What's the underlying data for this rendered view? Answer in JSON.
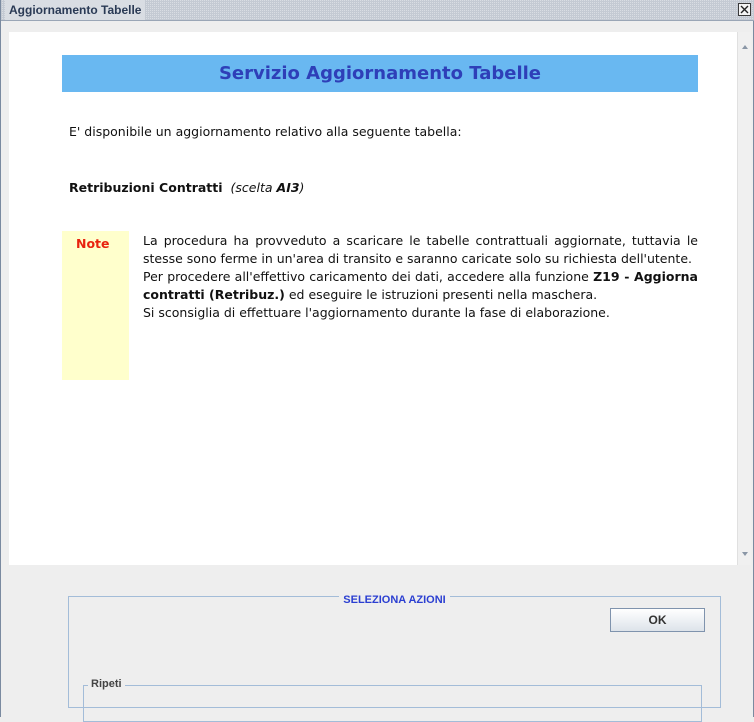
{
  "window": {
    "title": "Aggiornamento Tabelle",
    "close_icon": "close-icon"
  },
  "content": {
    "header": "Servizio Aggiornamento Tabelle",
    "intro": "E' disponibile un aggiornamento relativo alla seguente tabella:",
    "table_name": "Retribuzioni Contratti",
    "scelta_prefix": "(scelta",
    "scelta_code": "AI3",
    "scelta_suffix": ")",
    "note": {
      "label": "Note",
      "line1": "La procedura ha provveduto a scaricare le tabelle contrattuali aggiornate, tuttavia le stesse sono ferme in un'area di transito e saranno caricate solo su richiesta dell'utente.",
      "line2_pre": "Per procedere all'effettivo caricamento dei dati, accedere alla funzione ",
      "line2_bold": "Z19 - Aggiorna contratti (Retribuz.)",
      "line2_post": " ed eseguire le istruzioni presenti nella maschera.",
      "line3": "Si sconsiglia di effettuare l'aggiornamento durante la fase di elaborazione."
    }
  },
  "actions": {
    "legend": "SELEZIONA AZIONI",
    "ok_label": "OK",
    "ripeti_legend": "Ripeti"
  },
  "colors": {
    "header_bg": "#69b8f1",
    "header_text": "#2e3fb8",
    "note_bg": "#ffffcc",
    "note_label": "#e8230e",
    "legend_text": "#2b3fd1"
  }
}
